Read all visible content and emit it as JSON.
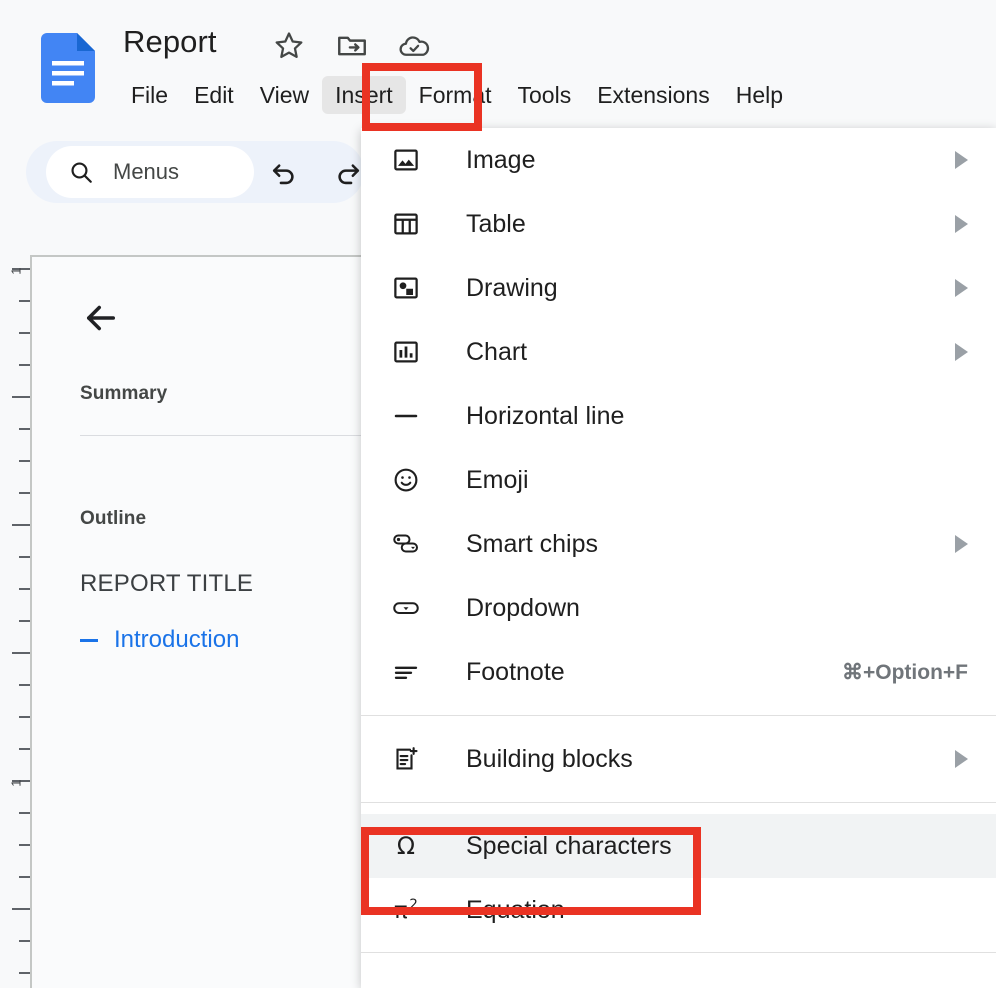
{
  "app": {
    "doc_title": "Report",
    "logo_icon": "google-docs-logo",
    "title_icons": [
      {
        "name": "star-icon",
        "label": "Star"
      },
      {
        "name": "move-to-folder-icon",
        "label": "Move"
      },
      {
        "name": "saved-to-drive-icon",
        "label": "Saved to Drive"
      }
    ]
  },
  "menubar": {
    "items": [
      {
        "label": "File",
        "active": false
      },
      {
        "label": "Edit",
        "active": false
      },
      {
        "label": "View",
        "active": false
      },
      {
        "label": "Insert",
        "active": true
      },
      {
        "label": "Format",
        "active": false
      },
      {
        "label": "Tools",
        "active": false
      },
      {
        "label": "Extensions",
        "active": false
      },
      {
        "label": "Help",
        "active": false
      }
    ]
  },
  "toolbar": {
    "search_icon": "search-icon",
    "search_placeholder": "Menus",
    "search_value": "",
    "undo_icon": "undo-icon",
    "redo_icon": "redo-icon"
  },
  "outline": {
    "back_icon": "back-arrow-icon",
    "summary_heading": "Summary",
    "outline_heading": "Outline",
    "doc_heading": "REPORT TITLE",
    "entries": [
      {
        "label": "Introduction",
        "selected": true
      }
    ]
  },
  "ruler": {
    "orientation": "vertical",
    "labels": [
      "1",
      "1"
    ]
  },
  "insert_menu": {
    "groups": [
      {
        "items": [
          {
            "label": "Image",
            "icon": "image-icon",
            "submenu": true,
            "shortcut": "",
            "hover": false
          },
          {
            "label": "Table",
            "icon": "table-icon",
            "submenu": true,
            "shortcut": "",
            "hover": false
          },
          {
            "label": "Drawing",
            "icon": "drawing-icon",
            "submenu": true,
            "shortcut": "",
            "hover": false
          },
          {
            "label": "Chart",
            "icon": "chart-icon",
            "submenu": true,
            "shortcut": "",
            "hover": false
          },
          {
            "label": "Horizontal line",
            "icon": "horizontal-line-icon",
            "submenu": false,
            "shortcut": "",
            "hover": false
          },
          {
            "label": "Emoji",
            "icon": "emoji-icon",
            "submenu": false,
            "shortcut": "",
            "hover": false
          },
          {
            "label": "Smart chips",
            "icon": "smart-chips-icon",
            "submenu": true,
            "shortcut": "",
            "hover": false
          },
          {
            "label": "Dropdown",
            "icon": "dropdown-icon",
            "submenu": false,
            "shortcut": "",
            "hover": false
          },
          {
            "label": "Footnote",
            "icon": "footnote-icon",
            "submenu": false,
            "shortcut": "⌘+Option+F",
            "hover": false
          }
        ]
      },
      {
        "items": [
          {
            "label": "Building blocks",
            "icon": "building-blocks-icon",
            "submenu": true,
            "shortcut": "",
            "hover": false
          }
        ]
      },
      {
        "items": [
          {
            "label": "Special characters",
            "icon": "omega-icon",
            "submenu": false,
            "shortcut": "",
            "hover": true
          },
          {
            "label": "Equation",
            "icon": "pi-squared-icon",
            "submenu": false,
            "shortcut": "",
            "hover": false
          }
        ]
      }
    ]
  },
  "annotations": {
    "color": "#ea3323",
    "boxes": [
      {
        "name": "insert-menu-highlight",
        "target": "Insert"
      },
      {
        "name": "special-characters-highlight",
        "target": "Special characters"
      }
    ]
  }
}
